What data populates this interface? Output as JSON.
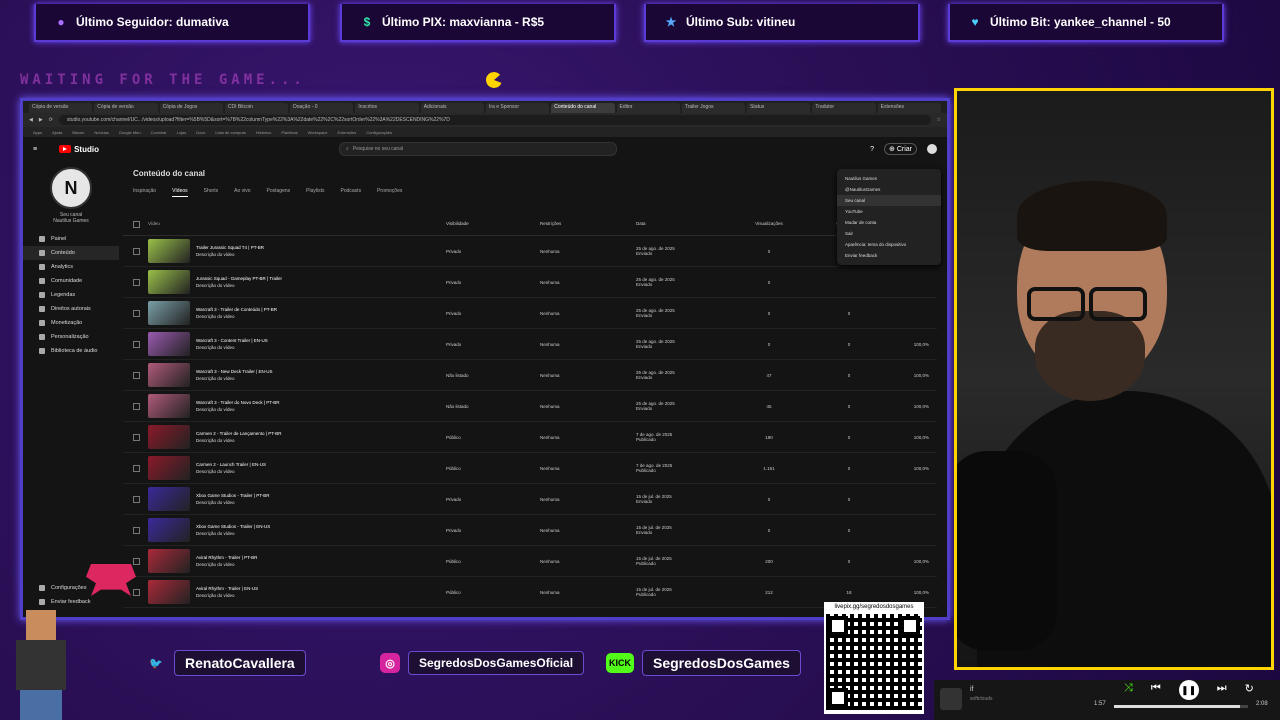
{
  "overlay": {
    "alerts": [
      {
        "icon": "twitch-icon",
        "label": "Último Seguidor: dumativa"
      },
      {
        "icon": "dollar-icon",
        "label": "Último PIX: maxvianna - R$5"
      },
      {
        "icon": "star-icon",
        "label": "Último Sub: vitineu"
      },
      {
        "icon": "heart-icon",
        "label": "Último Bit: yankee_channel - 50"
      }
    ],
    "waiting_text": "WAITING FOR THE GAME...",
    "social": [
      {
        "icon": "twitter-icon",
        "handle": "RenatoCavallera",
        "color": "#1da1f2"
      },
      {
        "icon": "instagram-icon",
        "handle": "SegredosDosGamesOficial",
        "color": "#d6249f"
      },
      {
        "icon": "kick-icon",
        "handle": "SegredosDosGames",
        "color": "#53fc18"
      }
    ],
    "qr_label": "livepix.gg/segredosdosgames",
    "player": {
      "title": "if",
      "artist": "softclouds",
      "elapsed": "1:57",
      "duration": "2:08",
      "progress": 0.94
    }
  },
  "browser": {
    "tabs": [
      "Cópia de versão",
      "Cópia de versão",
      "Cópia de Jogos",
      "CDI Bitcoin",
      "Doação - 0",
      "Inscritos",
      "Adicionais",
      "Ira e Sponsor",
      "Conteúdo do canal",
      "Editor",
      "Trailer Jogos",
      "Status",
      "Tradutor",
      "Extensões"
    ],
    "active_tab": 8,
    "url": "studio.youtube.com/channel/UC.../videos/upload?filter=%5B%5D&sort=%7B%22columnType%22%3A%22date%22%2C%22sortOrder%22%3A%22DESCENDING%22%7D",
    "bookmarks": [
      "Apps",
      "Ajuda",
      "Bitcoin",
      "Notícias",
      "Google Meu",
      "Cozinhar",
      "Lojas",
      "Docs",
      "Lista de compras",
      "Histórico",
      "Planilhas",
      "Workspace",
      "Extensões",
      "Configurações"
    ]
  },
  "studio": {
    "logo": "Studio",
    "search_placeholder": "Pesquise no seu canal",
    "create_label": "Criar",
    "channel_name": "Seu canal",
    "channel_sub": "Nautilus Games",
    "nav": [
      "Painel",
      "Conteúdo",
      "Analytics",
      "Comunidade",
      "Legendas",
      "Direitos autorais",
      "Monetização",
      "Personalização",
      "Biblioteca de áudio"
    ],
    "settings": "Configurações",
    "feedback": "Enviar feedback",
    "page_title": "Conteúdo do canal",
    "subtabs": [
      "Inspiração",
      "Vídeos",
      "Shorts",
      "Ao vivo",
      "Postagens",
      "Playlists",
      "Podcasts",
      "Promoções"
    ],
    "active_subtab": 1,
    "filter": "Filtrar",
    "columns": [
      "Vídeo",
      "Visibilidade",
      "Restrições",
      "Data",
      "Visualizações",
      "Comentários",
      "Marcações \"Gostei\" (vs. \"Não gostei\")"
    ],
    "rows": [
      {
        "title": "Trailer Jurassic Squad T4 | PT-BR",
        "desc": "Descrição do vídeo",
        "vis": "Privado",
        "rest": "Nenhuma",
        "date": "25 de ago. de 2025",
        "status": "Enviado",
        "views": "0",
        "comments": "",
        "likes": "",
        "thumb": "#9ac04a"
      },
      {
        "title": "Jurassic Squad - Gameplay PT-BR | Trailer",
        "desc": "Descrição do vídeo",
        "vis": "Privado",
        "rest": "Nenhuma",
        "date": "25 de ago. de 2025",
        "status": "Enviado",
        "views": "0",
        "comments": "",
        "likes": "",
        "thumb": "#9ac04a"
      },
      {
        "title": "Warcraft 3 - Trailer de Conteúdo | PT-BR",
        "desc": "Descrição do vídeo",
        "vis": "Privado",
        "rest": "Nenhuma",
        "date": "25 de ago. de 2025",
        "status": "Enviado",
        "views": "0",
        "comments": "0",
        "likes": "",
        "thumb": "#7aa0a8"
      },
      {
        "title": "Warcraft 3 - Content Trailer | EN-US",
        "desc": "Descrição do vídeo",
        "vis": "Privado",
        "rest": "Nenhuma",
        "date": "25 de ago. de 2025",
        "status": "Enviado",
        "views": "0",
        "comments": "0",
        "likes": "100,0%",
        "thumb": "#9a5ab0"
      },
      {
        "title": "Warcraft 3 - New Deck Trailer | EN-US",
        "desc": "Descrição do vídeo",
        "vis": "Não listado",
        "rest": "Nenhuma",
        "date": "25 de ago. de 2025",
        "status": "Enviado",
        "views": "47",
        "comments": "0",
        "likes": "100,0%",
        "thumb": "#b05a7a"
      },
      {
        "title": "Warcraft 3 - Trailer do Novo Deck | PT-BR",
        "desc": "Descrição do vídeo",
        "vis": "Não listado",
        "rest": "Nenhuma",
        "date": "25 de ago. de 2025",
        "status": "Enviado",
        "views": "45",
        "comments": "0",
        "likes": "100,0%",
        "thumb": "#b05a7a"
      },
      {
        "title": "Carmen 2 - Trailer de Lançamento | PT-BR",
        "desc": "Descrição do vídeo",
        "vis": "Público",
        "rest": "Nenhuma",
        "date": "7 de ago. de 2025",
        "status": "Publicado",
        "views": "190",
        "comments": "0",
        "likes": "100,0%",
        "thumb": "#8a1a2a"
      },
      {
        "title": "Carmen 2 - Launch Trailer | EN-US",
        "desc": "Descrição do vídeo",
        "vis": "Público",
        "rest": "Nenhuma",
        "date": "7 de ago. de 2025",
        "status": "Publicado",
        "views": "1.151",
        "comments": "0",
        "likes": "100,0%",
        "thumb": "#8a1a2a"
      },
      {
        "title": "Xbox Game Studios - Trailer | PT-BR",
        "desc": "Descrição do vídeo",
        "vis": "Privado",
        "rest": "Nenhuma",
        "date": "15 de jul. de 2025",
        "status": "Enviado",
        "views": "0",
        "comments": "0",
        "likes": "",
        "thumb": "#3a2a9a"
      },
      {
        "title": "Xbox Game Studios - Trailer | EN-US",
        "desc": "Descrição do vídeo",
        "vis": "Privado",
        "rest": "Nenhuma",
        "date": "15 de jul. de 2025",
        "status": "Enviado",
        "views": "0",
        "comments": "0",
        "likes": "",
        "thumb": "#3a2a9a"
      },
      {
        "title": "Aviral Rhythm - Trailer | PT-BR",
        "desc": "Descrição do vídeo",
        "vis": "Público",
        "rest": "Nenhuma",
        "date": "15 de jul. de 2025",
        "status": "Publicado",
        "views": "200",
        "comments": "0",
        "likes": "100,0%",
        "thumb": "#aa2a3a"
      },
      {
        "title": "Aviral Rhythm - Trailer | EN-US",
        "desc": "Descrição do vídeo",
        "vis": "Público",
        "rest": "Nenhuma",
        "date": "15 de jul. de 2025",
        "status": "Publicado",
        "views": "212",
        "comments": "18",
        "likes": "100,0%",
        "thumb": "#aa2a3a"
      }
    ],
    "account_menu": [
      "Nautilus Games",
      "@NautilusGames",
      "Seu canal",
      "YouTube",
      "Mudar de conta",
      "Sair",
      "Aparência: tema do dispositivo",
      "Enviar feedback"
    ]
  }
}
